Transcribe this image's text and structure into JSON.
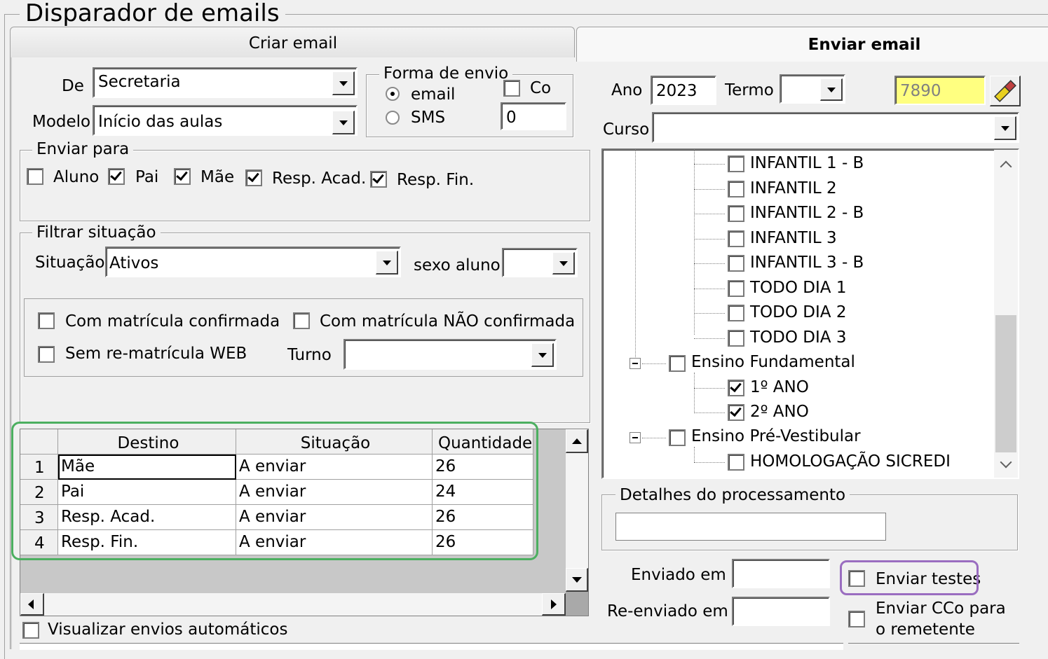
{
  "window": {
    "title": "Disparador de emails"
  },
  "tabs": {
    "create": "Criar email",
    "send": "Enviar email"
  },
  "left": {
    "de_label": "De",
    "de_value": "Secretaria",
    "modelo_label": "Modelo",
    "modelo_value": "Início das aulas",
    "forma": {
      "legend": "Forma de envio",
      "email": "email",
      "sms": "SMS",
      "co_label": "Co",
      "co_value": "0",
      "selected": "email"
    },
    "enviar_para": {
      "legend": "Enviar para",
      "items": [
        {
          "label": "Aluno",
          "checked": false
        },
        {
          "label": "Pai",
          "checked": true
        },
        {
          "label": "Mãe",
          "checked": true
        },
        {
          "label": "Resp. Acad.",
          "checked": true
        },
        {
          "label": "Resp. Fin.",
          "checked": true
        }
      ]
    },
    "filtrar": {
      "legend": "Filtrar situação",
      "situacao_label": "Situação",
      "situacao_value": "Ativos",
      "sexo_label": "sexo aluno",
      "sexo_value": "",
      "com_confirmada": "Com matrícula confirmada",
      "com_nao_confirmada": "Com matrícula NÃO confirmada",
      "sem_rematricula": "Sem re-matrícula WEB",
      "turno_label": "Turno",
      "turno_value": ""
    },
    "grid": {
      "headers": [
        "Destino",
        "Situação",
        "Quantidade"
      ],
      "rows": [
        {
          "n": "1",
          "destino": "Mãe",
          "situacao": "A enviar",
          "quantidade": "26"
        },
        {
          "n": "2",
          "destino": "Pai",
          "situacao": "A enviar",
          "quantidade": "24"
        },
        {
          "n": "3",
          "destino": "Resp. Acad.",
          "situacao": "A enviar",
          "quantidade": "26"
        },
        {
          "n": "4",
          "destino": "Resp. Fin.",
          "situacao": "A enviar",
          "quantidade": "26"
        }
      ]
    },
    "visualizar_auto": "Visualizar envios automáticos"
  },
  "right": {
    "ano_label": "Ano",
    "ano_value": "2023",
    "termo_label": "Termo",
    "termo_value": "",
    "code_value": "7890",
    "code_bg": "#ffff80",
    "curso_label": "Curso",
    "curso_value": "",
    "tree": [
      {
        "label": "INFANTIL 1 - B",
        "level": 2,
        "checked": false
      },
      {
        "label": "INFANTIL 2",
        "level": 2,
        "checked": false
      },
      {
        "label": "INFANTIL 2 - B",
        "level": 2,
        "checked": false
      },
      {
        "label": "INFANTIL 3",
        "level": 2,
        "checked": false
      },
      {
        "label": "INFANTIL 3 - B",
        "level": 2,
        "checked": false
      },
      {
        "label": "TODO DIA 1",
        "level": 2,
        "checked": false
      },
      {
        "label": "TODO DIA 2",
        "level": 2,
        "checked": false
      },
      {
        "label": "TODO DIA 3",
        "level": 2,
        "checked": false
      },
      {
        "label": "Ensino Fundamental",
        "level": 1,
        "checked": false
      },
      {
        "label": "1º ANO",
        "level": 2,
        "checked": true
      },
      {
        "label": "2º ANO",
        "level": 2,
        "checked": true
      },
      {
        "label": "Ensino Pré-Vestibular",
        "level": 1,
        "checked": false
      },
      {
        "label": "HOMOLOGAÇÃO SICREDI",
        "level": 2,
        "checked": false
      }
    ],
    "detalhes_legend": "Detalhes do processamento",
    "enviado_em_label": "Enviado em",
    "reenviado_em_label": "Re-enviado em",
    "enviar_testes": "Enviar testes",
    "enviar_cco_line1": "Enviar CCo para",
    "enviar_cco_line2": "o remetente"
  },
  "highlights": {
    "grid_color": "#4caf60",
    "testes_color": "#9a6dc0"
  }
}
